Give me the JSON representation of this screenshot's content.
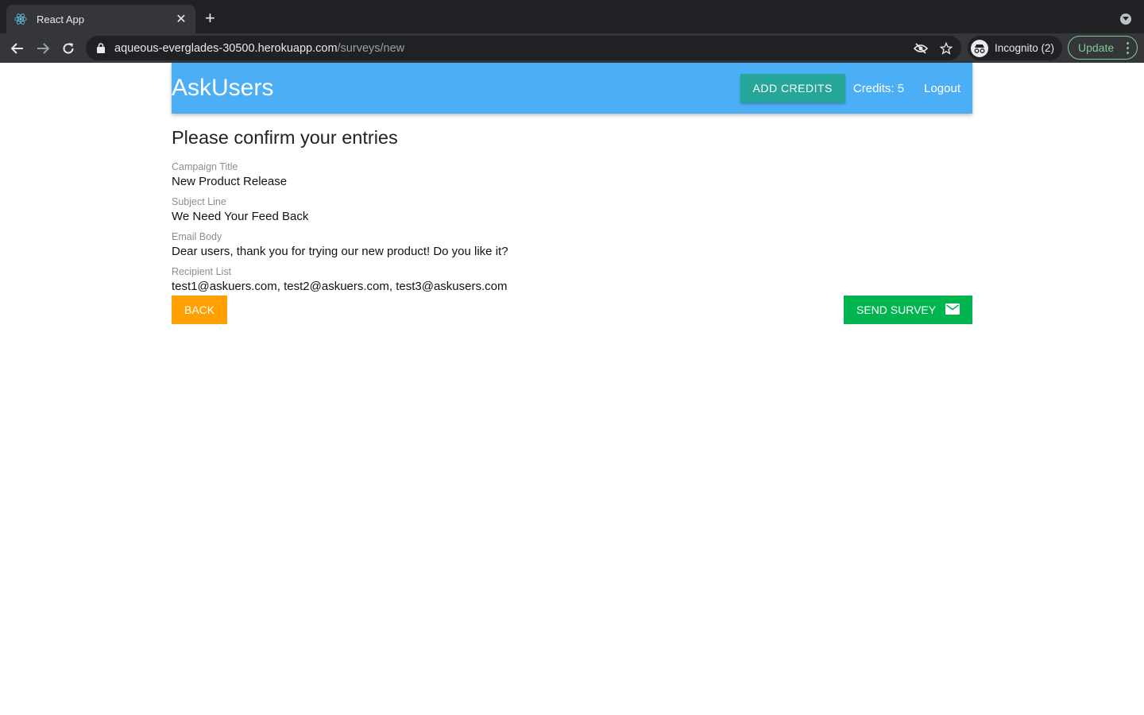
{
  "browser": {
    "tab_title": "React App",
    "url_host": "aqueous-everglades-30500.herokuapp.com",
    "url_path": "/surveys/new",
    "incognito_label": "Incognito (2)",
    "update_label": "Update"
  },
  "navbar": {
    "brand": "AskUsers",
    "add_credits_label": "ADD CREDITS",
    "credits_text": "Credits: 5",
    "logout_label": "Logout",
    "color": "#4caff6"
  },
  "review": {
    "heading": "Please confirm your entries",
    "fields": [
      {
        "label": "Campaign Title",
        "value": "New Product Release"
      },
      {
        "label": "Subject Line",
        "value": "We Need Your Feed Back"
      },
      {
        "label": "Email Body",
        "value": "Dear users, thank you for trying our new product! Do you like it?"
      },
      {
        "label": "Recipient List",
        "value": "test1@askuers.com, test2@askuers.com, test3@askusers.com"
      }
    ],
    "back_label": "BACK",
    "send_label": "SEND SURVEY",
    "send_icon": "mail-icon"
  }
}
